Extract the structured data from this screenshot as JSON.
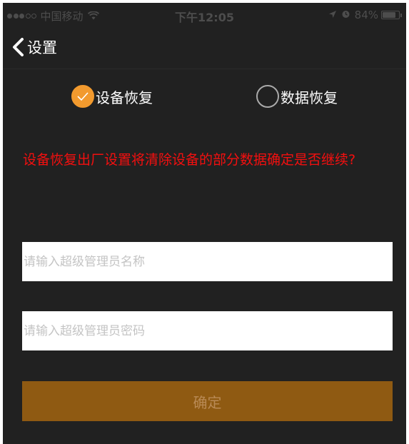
{
  "status_bar": {
    "carrier": "中国移动",
    "signal_dots": [
      true,
      true,
      true,
      false,
      false
    ],
    "wifi_icon": "wifi-icon",
    "time": "下午12:05",
    "location_icon": "location-arrow-icon",
    "alarm_icon": "alarm-clock-icon",
    "battery_percent": "84%",
    "battery_level": 0.84
  },
  "nav": {
    "back_icon": "chevron-left-icon",
    "title": "设置"
  },
  "options": {
    "device_restore": {
      "label": "设备恢复",
      "checked": true
    },
    "data_restore": {
      "label": "数据恢复",
      "checked": false
    }
  },
  "warning_text": "设备恢复出厂设置将清除设备的部分数据确定是否继续?",
  "form": {
    "admin_name_placeholder": "请输入超级管理员名称",
    "admin_name_value": "",
    "admin_password_placeholder": "请输入超级管理员密码",
    "admin_password_value": ""
  },
  "confirm_label": "确定",
  "colors": {
    "background": "#212121",
    "accent": "#f29a2e",
    "warning": "#f40f0f",
    "confirm_button": "#8f5a12",
    "confirm_text": "#b98a55"
  }
}
